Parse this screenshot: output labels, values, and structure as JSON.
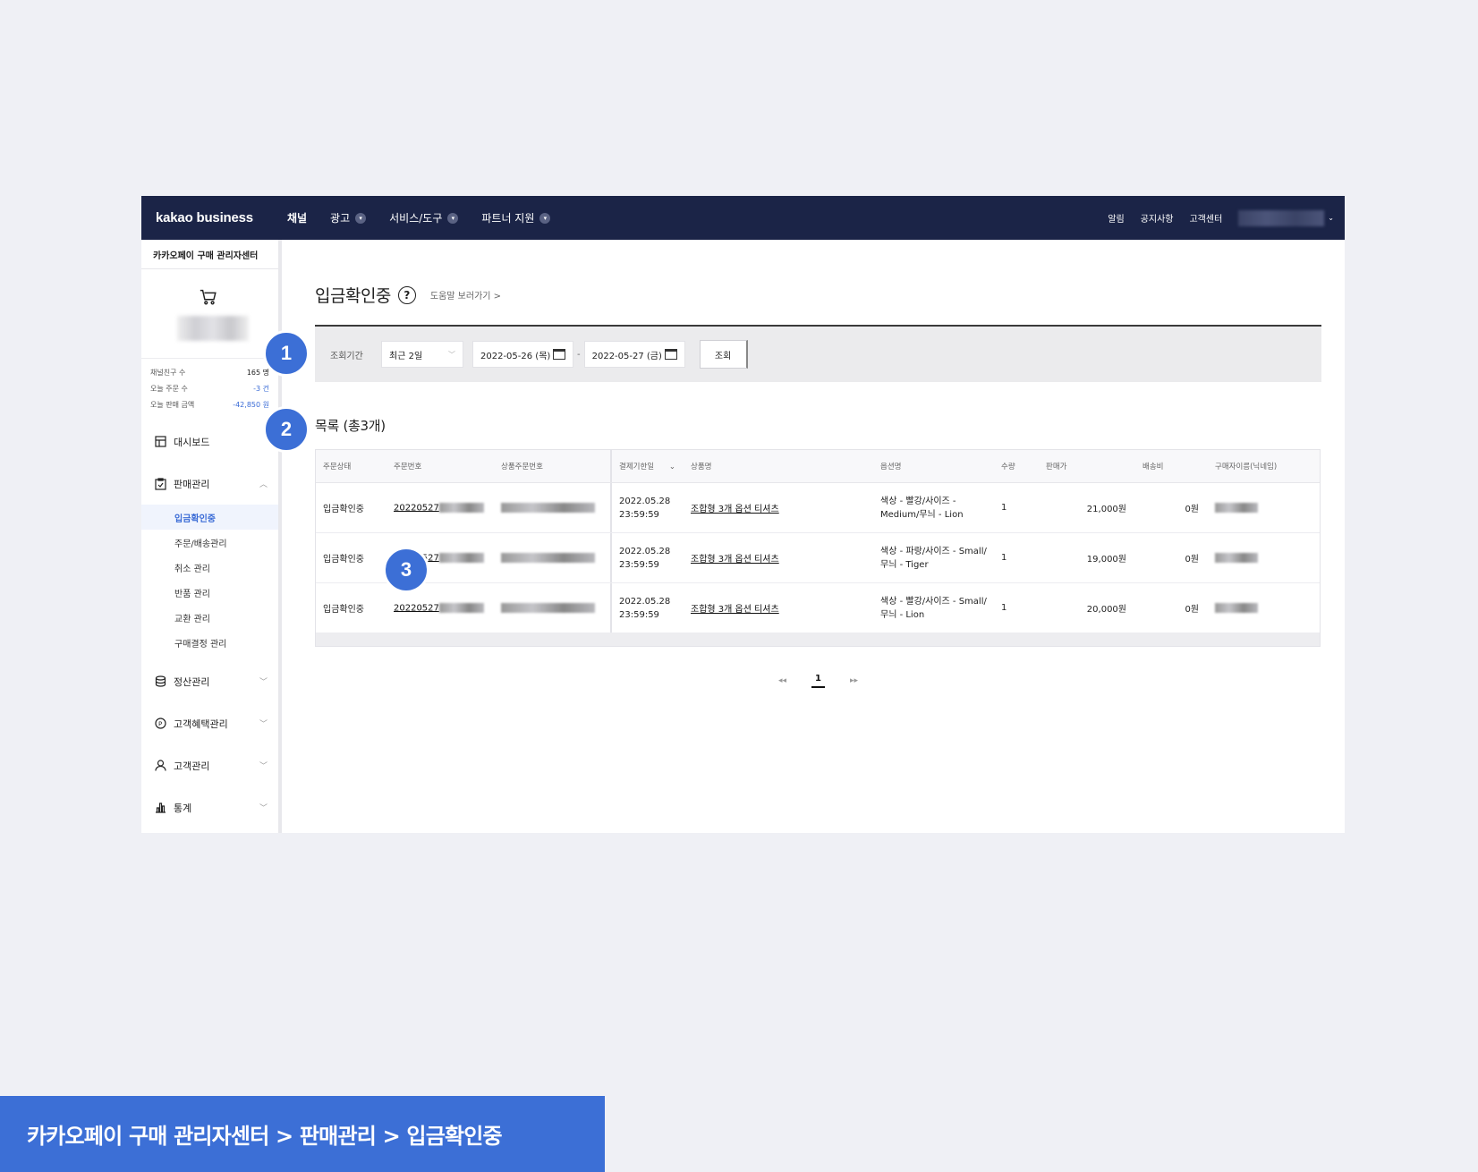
{
  "topbar": {
    "logo": "kakao business",
    "nav": [
      {
        "label": "채널",
        "dropdown": false
      },
      {
        "label": "광고",
        "dropdown": true
      },
      {
        "label": "서비스/도구",
        "dropdown": true
      },
      {
        "label": "파트너 지원",
        "dropdown": true
      }
    ],
    "right": [
      "알림",
      "공지사항",
      "고객센터"
    ]
  },
  "sidebar": {
    "title": "카카오페이 구매 관리자센터",
    "stats": [
      {
        "label": "채널친구 수",
        "value": "165 명"
      },
      {
        "label": "오늘 주문 수",
        "value": "-3 건"
      },
      {
        "label": "오늘 판매 금액",
        "value": "-42,850 원"
      }
    ],
    "menu": {
      "dashboard": "대시보드",
      "sales": "판매관리",
      "sales_sub": [
        "입금확인중",
        "주문/배송관리",
        "취소 관리",
        "반품 관리",
        "교환 관리",
        "구매결정 관리"
      ],
      "settlement": "정산관리",
      "benefit": "고객혜택관리",
      "customer": "고객관리",
      "stats": "통계"
    }
  },
  "main": {
    "title": "입금확인중",
    "help_icon": "?",
    "help_link": "도움말 보러가기 >",
    "filter": {
      "label": "조회기간",
      "period": "최근 2일",
      "start_date": "2022-05-26 (목)",
      "end_date": "2022-05-27 (금)",
      "separator": "-",
      "search_button": "조회"
    },
    "list_title": "목록 (총3개)",
    "columns": [
      "주문상태",
      "주문번호",
      "상품주문번호",
      "결제기한일",
      "상품명",
      "옵션명",
      "수량",
      "판매가",
      "배송비",
      "구매자이름(닉네임)"
    ],
    "rows": [
      {
        "status": "입금확인중",
        "order_no": "20220527",
        "deadline_date": "2022.05.28",
        "deadline_time": "23:59:59",
        "product": "조합형 3개 옵션 티셔츠",
        "option": "색상 - 빨강/사이즈 - Medium/무늬 - Lion",
        "qty": "1",
        "price": "21,000원",
        "shipping": "0원"
      },
      {
        "status": "입금확인중",
        "order_no": "20220527",
        "deadline_date": "2022.05.28",
        "deadline_time": "23:59:59",
        "product": "조합형 3개 옵션 티셔츠",
        "option": "색상 - 파랑/사이즈 - Small/무늬 - Tiger",
        "qty": "1",
        "price": "19,000원",
        "shipping": "0원"
      },
      {
        "status": "입금확인중",
        "order_no": "20220527",
        "deadline_date": "2022.05.28",
        "deadline_time": "23:59:59",
        "product": "조합형 3개 옵션 티셔츠",
        "option": "색상 - 빨강/사이즈 - Small/무늬 - Lion",
        "qty": "1",
        "price": "20,000원",
        "shipping": "0원"
      }
    ],
    "pager": {
      "first": "◂◂",
      "current": "1",
      "last": "▸▸"
    }
  },
  "badges": [
    "1",
    "2",
    "3"
  ],
  "breadcrumb": "카카오페이 구매 관리자센터 > 판매관리 > 입금확인중",
  "colors": {
    "navy": "#1b2447",
    "accent": "#3c6fd6",
    "background": "#eff0f5"
  }
}
